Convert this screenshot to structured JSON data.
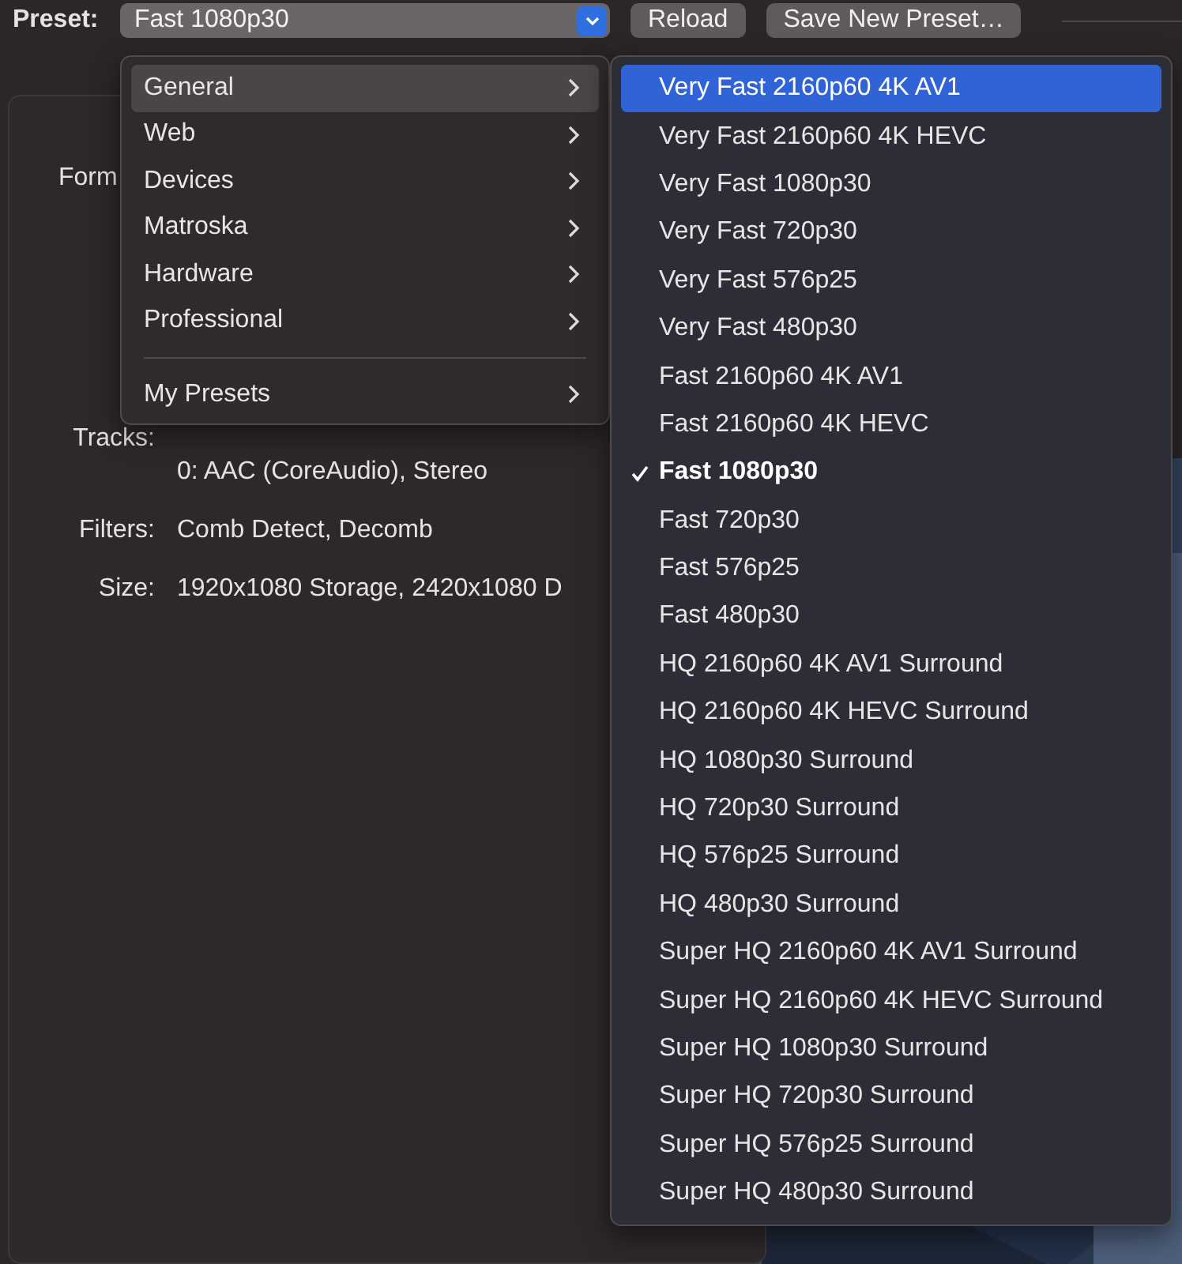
{
  "preset_bar": {
    "label": "Preset:",
    "value": "Fast 1080p30",
    "buttons": [
      "Reload",
      "Save New Preset…"
    ]
  },
  "summary": [
    {
      "label": "Form"
    },
    {
      "label": "Tracks:",
      "values": [
        "0: AAC (CoreAudio), Stereo"
      ]
    },
    {
      "label": "Filters:",
      "values": [
        "Comb Detect, Decomb"
      ]
    },
    {
      "label": "Size:",
      "values": [
        "1920x1080 Storage, 2420x1080 D"
      ]
    }
  ],
  "category_menu": {
    "items": [
      {
        "kind": "item",
        "label": "General",
        "selected": true
      },
      {
        "kind": "item",
        "label": "Web",
        "selected": false
      },
      {
        "kind": "item",
        "label": "Devices",
        "selected": false
      },
      {
        "kind": "item",
        "label": "Matroska",
        "selected": false
      },
      {
        "kind": "item",
        "label": "Hardware",
        "selected": false
      },
      {
        "kind": "item",
        "label": "Professional",
        "selected": false
      },
      {
        "kind": "separator"
      },
      {
        "kind": "item",
        "label": "My Presets",
        "selected": false
      }
    ]
  },
  "preset_menu": {
    "items": [
      {
        "label": "Very Fast 2160p60 4K AV1",
        "selected": true,
        "checked": false
      },
      {
        "label": "Very Fast 2160p60 4K HEVC",
        "selected": false,
        "checked": false
      },
      {
        "label": "Very Fast 1080p30",
        "selected": false,
        "checked": false
      },
      {
        "label": "Very Fast 720p30",
        "selected": false,
        "checked": false
      },
      {
        "label": "Very Fast 576p25",
        "selected": false,
        "checked": false
      },
      {
        "label": "Very Fast 480p30",
        "selected": false,
        "checked": false
      },
      {
        "label": "Fast 2160p60 4K AV1",
        "selected": false,
        "checked": false
      },
      {
        "label": "Fast 2160p60 4K HEVC",
        "selected": false,
        "checked": false
      },
      {
        "label": "Fast 1080p30",
        "selected": false,
        "checked": true
      },
      {
        "label": "Fast 720p30",
        "selected": false,
        "checked": false
      },
      {
        "label": "Fast 576p25",
        "selected": false,
        "checked": false
      },
      {
        "label": "Fast 480p30",
        "selected": false,
        "checked": false
      },
      {
        "label": "HQ 2160p60 4K AV1 Surround",
        "selected": false,
        "checked": false
      },
      {
        "label": "HQ 2160p60 4K HEVC Surround",
        "selected": false,
        "checked": false
      },
      {
        "label": "HQ 1080p30 Surround",
        "selected": false,
        "checked": false
      },
      {
        "label": "HQ 720p30 Surround",
        "selected": false,
        "checked": false
      },
      {
        "label": "HQ 576p25 Surround",
        "selected": false,
        "checked": false
      },
      {
        "label": "HQ 480p30 Surround",
        "selected": false,
        "checked": false
      },
      {
        "label": "Super HQ 2160p60 4K AV1 Surround",
        "selected": false,
        "checked": false
      },
      {
        "label": "Super HQ 2160p60 4K HEVC Surround",
        "selected": false,
        "checked": false
      },
      {
        "label": "Super HQ 1080p30 Surround",
        "selected": false,
        "checked": false
      },
      {
        "label": "Super HQ 720p30 Surround",
        "selected": false,
        "checked": false
      },
      {
        "label": "Super HQ 576p25 Surround",
        "selected": false,
        "checked": false
      },
      {
        "label": "Super HQ 480p30 Surround",
        "selected": false,
        "checked": false
      }
    ]
  }
}
